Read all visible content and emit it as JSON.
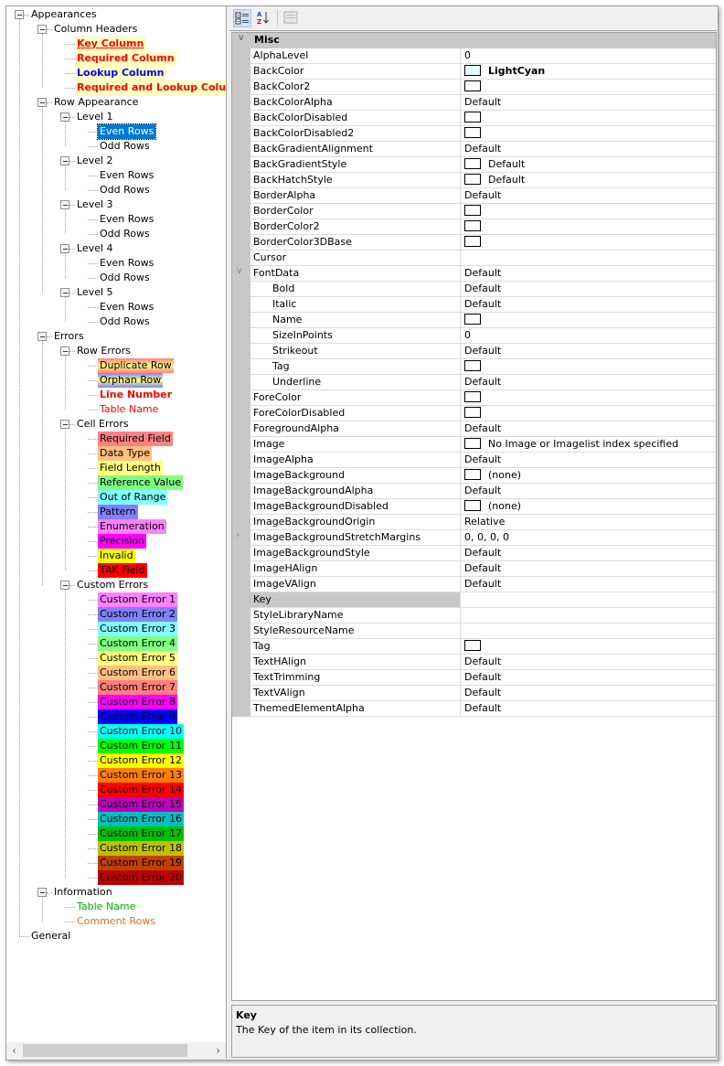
{
  "tree": {
    "nodes": [
      {
        "label": "Appearances",
        "level": 0,
        "expandable": true
      },
      {
        "label": "Column Headers",
        "level": 1,
        "expandable": true
      },
      {
        "label": "Key Column",
        "level": 2,
        "bg": "#ffffc0",
        "fg": "#ff0000",
        "bold": true,
        "underline": true
      },
      {
        "label": "Required Column",
        "level": 2,
        "bg": "#ffffc0",
        "fg": "#ff0000",
        "bold": true
      },
      {
        "label": "Lookup Column",
        "level": 2,
        "bg": "#ffffc0",
        "fg": "#0000ff",
        "bold": true
      },
      {
        "label": "Required and Lookup Colum",
        "level": 2,
        "bg": "#ffffc0",
        "fg": "#ff0000",
        "bold": true
      },
      {
        "label": "Row Appearance",
        "level": 1,
        "expandable": true
      },
      {
        "label": "Level 1",
        "level": 2,
        "expandable": true
      },
      {
        "label": "Even Rows",
        "level": 3,
        "selected": true
      },
      {
        "label": "Odd Rows",
        "level": 3
      },
      {
        "label": "Level 2",
        "level": 2,
        "expandable": true
      },
      {
        "label": "Even Rows",
        "level": 3
      },
      {
        "label": "Odd Rows",
        "level": 3
      },
      {
        "label": "Level 3",
        "level": 2,
        "expandable": true
      },
      {
        "label": "Even Rows",
        "level": 3
      },
      {
        "label": "Odd Rows",
        "level": 3
      },
      {
        "label": "Level 4",
        "level": 2,
        "expandable": true
      },
      {
        "label": "Even Rows",
        "level": 3
      },
      {
        "label": "Odd Rows",
        "level": 3
      },
      {
        "label": "Level 5",
        "level": 2,
        "expandable": true
      },
      {
        "label": "Even Rows",
        "level": 3
      },
      {
        "label": "Odd Rows",
        "level": 3
      },
      {
        "label": "Errors",
        "level": 1,
        "expandable": true
      },
      {
        "label": "Row Errors",
        "level": 2,
        "expandable": true
      },
      {
        "label": "Duplicate Row",
        "level": 3,
        "bg": "linear-gradient(#ff8080,#ffff80,#ff8080)"
      },
      {
        "label": "Orphan Row",
        "level": 3,
        "bg": "linear-gradient(#8080ff,#ffff80,#8080ff)"
      },
      {
        "label": "Line Number",
        "level": 3,
        "fg": "#ff0000",
        "bold": true
      },
      {
        "label": "Table Name",
        "level": 3,
        "fg": "#ff0000"
      },
      {
        "label": "Cell Errors",
        "level": 2,
        "expandable": true
      },
      {
        "label": "Required Field",
        "level": 3,
        "bg": "#ff8080"
      },
      {
        "label": "Data Type",
        "level": 3,
        "bg": "#ffc080"
      },
      {
        "label": "Field Length",
        "level": 3,
        "bg": "#ffff80"
      },
      {
        "label": "Reference Value",
        "level": 3,
        "bg": "#80ff80"
      },
      {
        "label": "Out of Range",
        "level": 3,
        "bg": "#80ffff"
      },
      {
        "label": "Pattern",
        "level": 3,
        "bg": "#8080ff"
      },
      {
        "label": "Enumeration",
        "level": 3,
        "bg": "#ff80ff"
      },
      {
        "label": "Precision",
        "level": 3,
        "bg": "#ff00ff"
      },
      {
        "label": "Invalid",
        "level": 3,
        "bg": "#ffff00"
      },
      {
        "label": "TAK Field",
        "level": 3,
        "bg": "#ff0000"
      },
      {
        "label": "Custom Errors",
        "level": 2,
        "expandable": true
      },
      {
        "label": "Custom Error 1",
        "level": 3,
        "bg": "#ff80ff"
      },
      {
        "label": "Custom Error 2",
        "level": 3,
        "bg": "#8080ff"
      },
      {
        "label": "Custom Error 3",
        "level": 3,
        "bg": "#80ffff"
      },
      {
        "label": "Custom Error 4",
        "level": 3,
        "bg": "#80ff80"
      },
      {
        "label": "Custom Error 5",
        "level": 3,
        "bg": "#ffff80"
      },
      {
        "label": "Custom Error 6",
        "level": 3,
        "bg": "#ffc080"
      },
      {
        "label": "Custom Error 7",
        "level": 3,
        "bg": "#ff8080"
      },
      {
        "label": "Custom Error 8",
        "level": 3,
        "bg": "#ff00ff"
      },
      {
        "label": "Custom Error 9",
        "level": 3,
        "bg": "#0000ff"
      },
      {
        "label": "Custom Error 10",
        "level": 3,
        "bg": "#00ffff"
      },
      {
        "label": "Custom Error 11",
        "level": 3,
        "bg": "#00ff00"
      },
      {
        "label": "Custom Error 12",
        "level": 3,
        "bg": "#ffff00"
      },
      {
        "label": "Custom Error 13",
        "level": 3,
        "bg": "#ff8000"
      },
      {
        "label": "Custom Error 14",
        "level": 3,
        "bg": "#ff0000"
      },
      {
        "label": "Custom Error 15",
        "level": 3,
        "bg": "#c000c0"
      },
      {
        "label": "Custom Error 16",
        "level": 3,
        "bg": "#00c0c0"
      },
      {
        "label": "Custom Error 17",
        "level": 3,
        "bg": "#00c000"
      },
      {
        "label": "Custom Error 18",
        "level": 3,
        "bg": "#c0c000"
      },
      {
        "label": "Custom Error 19",
        "level": 3,
        "bg": "#c04000"
      },
      {
        "label": "Custom Error 20",
        "level": 3,
        "bg": "#c00000"
      },
      {
        "label": "Information",
        "level": 1,
        "expandable": true
      },
      {
        "label": "Table Name",
        "level": 2,
        "fg": "#00b000"
      },
      {
        "label": "Comment Rows",
        "level": 2,
        "fg": "#e07030"
      },
      {
        "label": "General",
        "level": 0
      }
    ],
    "scroll_left_icon": "chevron-left",
    "scroll_right_icon": "chevron-right"
  },
  "toolbar": {
    "categorized_icon": "categorized-icon",
    "alphabetical_icon": "sort-az-icon",
    "property_pages_icon": "property-pages-icon"
  },
  "grid": {
    "category": "Misc",
    "rows": [
      {
        "name": "AlphaLevel",
        "value": "0"
      },
      {
        "name": "BackColor",
        "value": "LightCyan",
        "swatch": "#e0ffff",
        "bold": true
      },
      {
        "name": "BackColor2",
        "value": "",
        "swatch": "#ffffff"
      },
      {
        "name": "BackColorAlpha",
        "value": "Default"
      },
      {
        "name": "BackColorDisabled",
        "value": "",
        "swatch": "#ffffff"
      },
      {
        "name": "BackColorDisabled2",
        "value": "",
        "swatch": "#ffffff"
      },
      {
        "name": "BackGradientAlignment",
        "value": "Default"
      },
      {
        "name": "BackGradientStyle",
        "value": "Default",
        "swatch": "#ffffff"
      },
      {
        "name": "BackHatchStyle",
        "value": "Default",
        "swatch": "#ffffff"
      },
      {
        "name": "BorderAlpha",
        "value": "Default"
      },
      {
        "name": "BorderColor",
        "value": "",
        "swatch": "#ffffff"
      },
      {
        "name": "BorderColor2",
        "value": "",
        "swatch": "#ffffff"
      },
      {
        "name": "BorderColor3DBase",
        "value": "",
        "swatch": "#ffffff"
      },
      {
        "name": "Cursor",
        "value": ""
      },
      {
        "name": "FontData",
        "value": "Default",
        "expanded": true
      },
      {
        "name": "Bold",
        "value": "Default",
        "sub": true
      },
      {
        "name": "Italic",
        "value": "Default",
        "sub": true
      },
      {
        "name": "Name",
        "value": "",
        "swatch": "#ffffff",
        "sub": true
      },
      {
        "name": "SizeInPoints",
        "value": "0",
        "sub": true
      },
      {
        "name": "Strikeout",
        "value": "Default",
        "sub": true
      },
      {
        "name": "Tag",
        "value": "",
        "swatch": "#ffffff",
        "sub": true
      },
      {
        "name": "Underline",
        "value": "Default",
        "sub": true
      },
      {
        "name": "ForeColor",
        "value": "",
        "swatch": "#ffffff"
      },
      {
        "name": "ForeColorDisabled",
        "value": "",
        "swatch": "#ffffff"
      },
      {
        "name": "ForegroundAlpha",
        "value": "Default"
      },
      {
        "name": "Image",
        "value": "No Image or Imagelist index specified",
        "swatch": "#ffffff"
      },
      {
        "name": "ImageAlpha",
        "value": "Default"
      },
      {
        "name": "ImageBackground",
        "value": "(none)",
        "swatch": "#ffffff"
      },
      {
        "name": "ImageBackgroundAlpha",
        "value": "Default"
      },
      {
        "name": "ImageBackgroundDisabled",
        "value": "(none)",
        "swatch": "#ffffff"
      },
      {
        "name": "ImageBackgroundOrigin",
        "value": "Relative"
      },
      {
        "name": "ImageBackgroundStretchMargins",
        "value": "0, 0, 0, 0",
        "collapsed": true
      },
      {
        "name": "ImageBackgroundStyle",
        "value": "Default"
      },
      {
        "name": "ImageHAlign",
        "value": "Default"
      },
      {
        "name": "ImageVAlign",
        "value": "Default"
      },
      {
        "name": "Key",
        "value": "",
        "selected": true
      },
      {
        "name": "StyleLibraryName",
        "value": ""
      },
      {
        "name": "StyleResourceName",
        "value": ""
      },
      {
        "name": "Tag",
        "value": "",
        "swatch": "#ffffff"
      },
      {
        "name": "TextHAlign",
        "value": "Default"
      },
      {
        "name": "TextTrimming",
        "value": "Default"
      },
      {
        "name": "TextVAlign",
        "value": "Default"
      },
      {
        "name": "ThemedElementAlpha",
        "value": "Default"
      }
    ]
  },
  "description": {
    "title": "Key",
    "text": "The Key of the item in its collection."
  }
}
